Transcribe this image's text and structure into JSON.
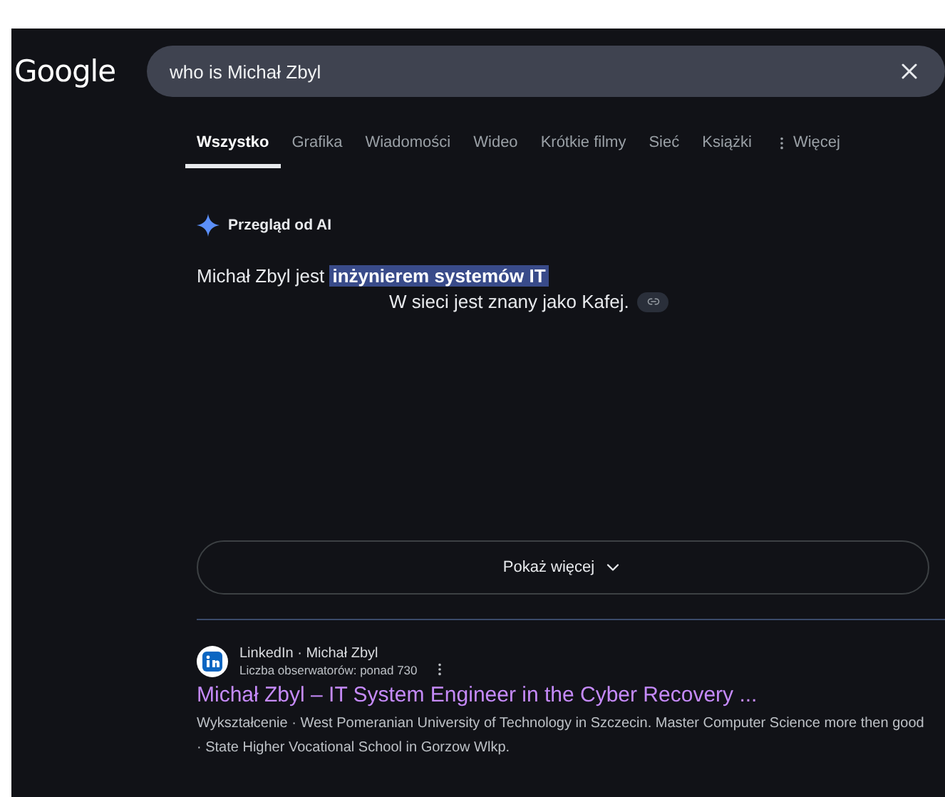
{
  "header": {
    "logo": "Google",
    "search": {
      "value": "who is Michał Zbyl"
    }
  },
  "tabs": [
    {
      "label": "Wszystko",
      "selected": true
    },
    {
      "label": "Grafika",
      "selected": false
    },
    {
      "label": "Wiadomości",
      "selected": false
    },
    {
      "label": "Wideo",
      "selected": false
    },
    {
      "label": "Krótkie filmy",
      "selected": false
    },
    {
      "label": "Sieć",
      "selected": false
    },
    {
      "label": "Książki",
      "selected": false
    },
    {
      "label": "Więcej",
      "selected": false,
      "kind": "more"
    }
  ],
  "ai_overview": {
    "title": "Przegląd od AI",
    "line_1": "Michał Zbyl jest ",
    "highlight": "inżynierem systemów IT",
    "line_2": "W sieci jest znany jako Kafej.",
    "show_more": "Pokaż więcej"
  },
  "results": [
    {
      "source": "LinkedIn · Michał Zbyl",
      "meta": "Liczba obserwatorów: ponad 730",
      "title": "Michał Zbyl – IT System Engineer in the Cyber Recovery ...",
      "snippet": "Wykształcenie · West Pomeranian University of Technology in Szczecin. Master Computer Science more then good · State Higher Vocational School in Gorzow Wlkp."
    }
  ]
}
